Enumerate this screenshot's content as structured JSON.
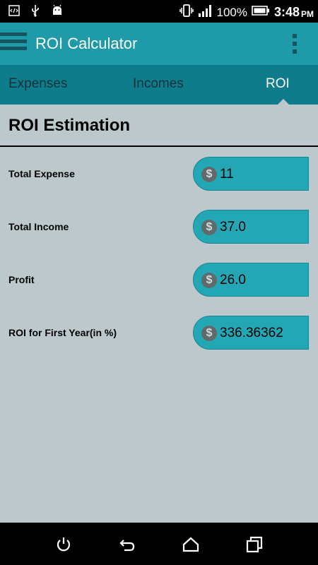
{
  "status_bar": {
    "battery": "100%",
    "time": "3:48",
    "ampm": "PM"
  },
  "app_bar": {
    "title": "ROI Calculator"
  },
  "tabs": [
    {
      "label": "Expenses"
    },
    {
      "label": "Incomes"
    },
    {
      "label": "ROI",
      "active": true
    }
  ],
  "section": {
    "title": "ROI Estimation"
  },
  "rows": [
    {
      "label": "Total Expense",
      "currency_symbol": "$",
      "value": "11"
    },
    {
      "label": "Total Income",
      "currency_symbol": "$",
      "value": "37.0"
    },
    {
      "label": "Profit",
      "currency_symbol": "$",
      "value": "26.0"
    },
    {
      "label": "ROI for First Year(in %)",
      "currency_symbol": "$",
      "value": "336.36362"
    }
  ],
  "colors": {
    "app_bar": "#1f9aa8",
    "tab_bar": "#0f7c8c",
    "background": "#bcc8cb",
    "field": "#24a7b5"
  }
}
